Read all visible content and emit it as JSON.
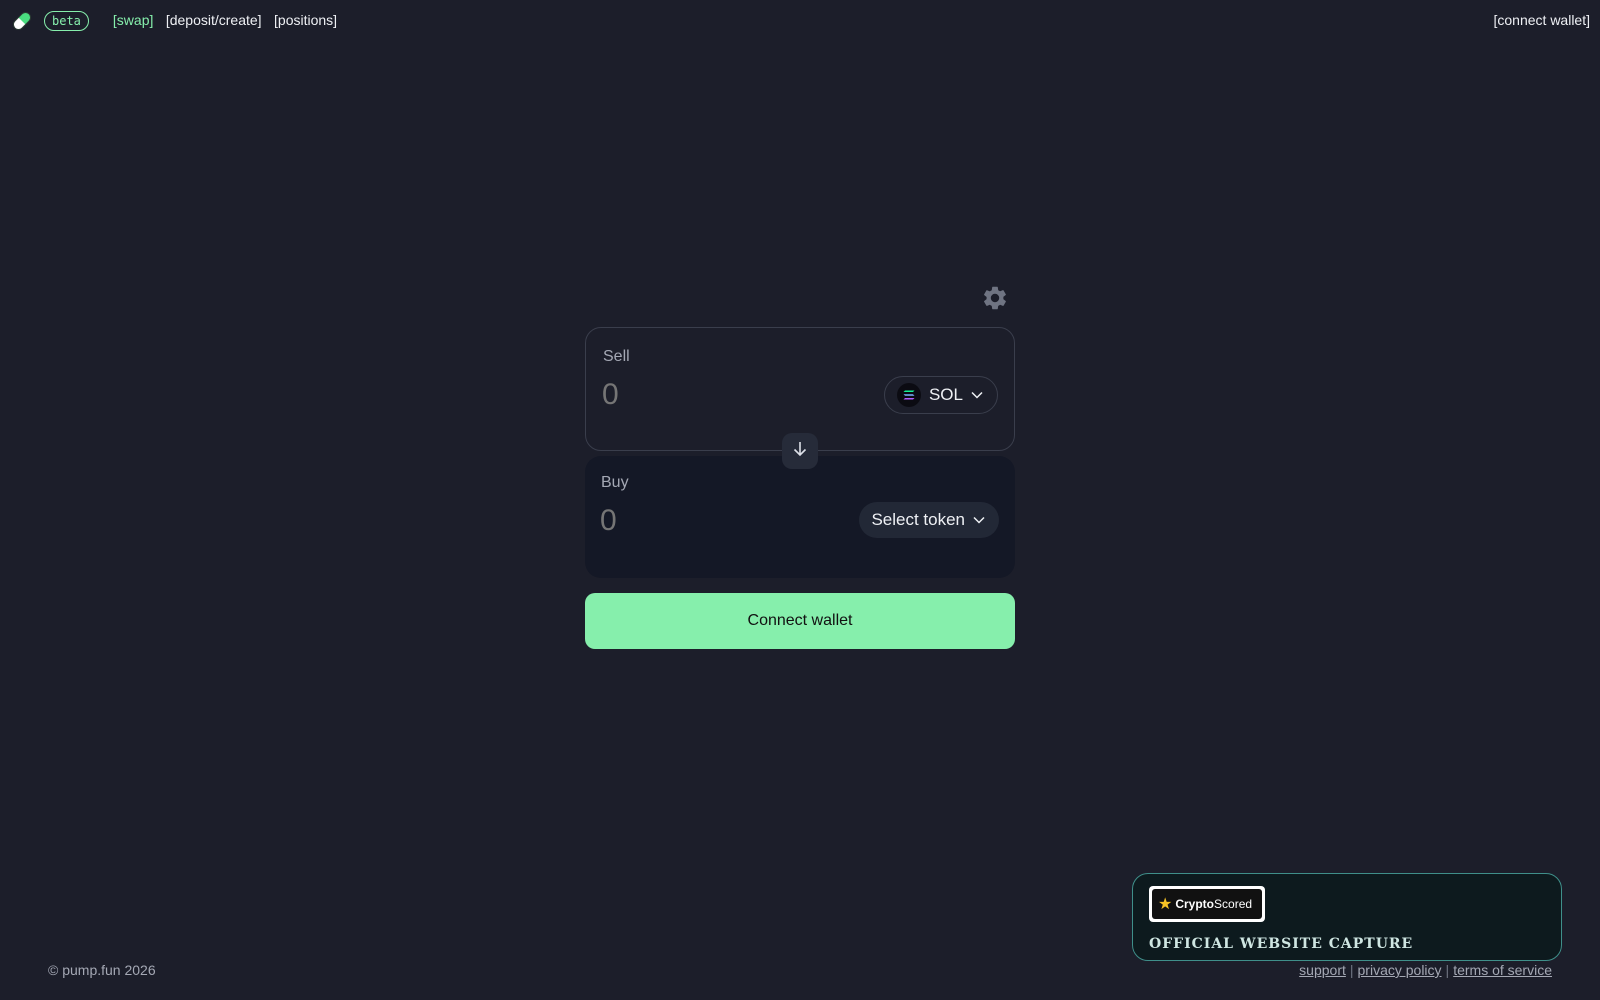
{
  "header": {
    "beta_badge": "beta",
    "nav": [
      {
        "label": "[swap]",
        "active": true
      },
      {
        "label": "[deposit/create]",
        "active": false
      },
      {
        "label": "[positions]",
        "active": false
      }
    ],
    "connect_wallet": "[connect wallet]"
  },
  "swap": {
    "sell": {
      "label": "Sell",
      "amount": "0",
      "token": "SOL"
    },
    "buy": {
      "label": "Buy",
      "amount": "0",
      "token_button": "Select token"
    },
    "connect_button": "Connect wallet"
  },
  "footer": {
    "copyright": "© pump.fun 2026",
    "links": [
      "support",
      "privacy policy",
      "terms of service"
    ]
  },
  "capture_badge": {
    "logo_text_bold": "Crypto",
    "logo_text_rest": "Scored",
    "caption": "OFFICIAL WEBSITE CAPTURE"
  },
  "colors": {
    "background": "#1c1e2a",
    "accent": "#86efac",
    "buy_panel": "#141826"
  },
  "icons": [
    "pill-logo-icon",
    "settings-gear-icon",
    "solana-icon",
    "chevron-down-icon",
    "arrow-down-icon",
    "star-icon"
  ]
}
